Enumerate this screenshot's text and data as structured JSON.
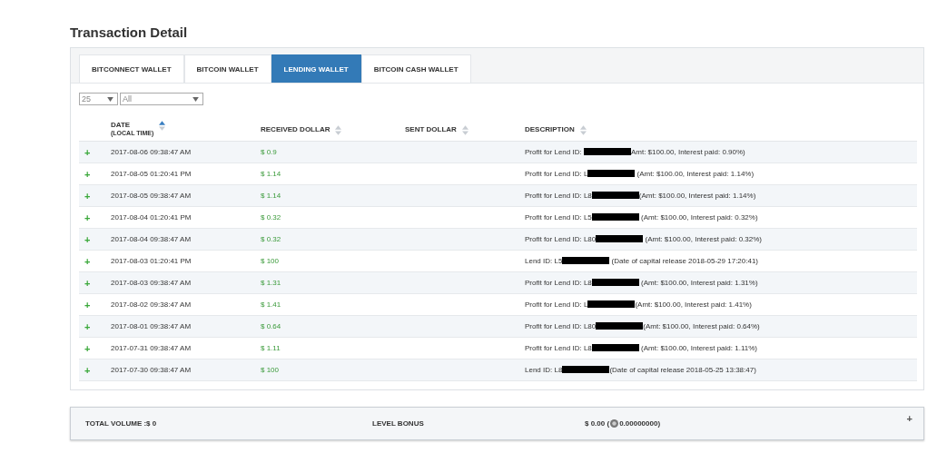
{
  "title": "Transaction Detail",
  "tabs": [
    {
      "label": "BITCONNECT WALLET",
      "selected": false
    },
    {
      "label": "BITCOIN WALLET",
      "selected": false
    },
    {
      "label": "LENDING WALLET",
      "selected": true
    },
    {
      "label": "BITCOIN CASH WALLET",
      "selected": false
    }
  ],
  "filters": {
    "page_size": "25",
    "type": "All"
  },
  "columns": [
    {
      "label": "DATE",
      "sublabel": "(LOCAL TIME)",
      "sorted": true
    },
    {
      "label": "RECEIVED DOLLAR",
      "sorted": false
    },
    {
      "label": "SENT DOLLAR",
      "sorted": false
    },
    {
      "label": "DESCRIPTION",
      "sorted": false
    }
  ],
  "rows": [
    {
      "expand": "+",
      "date": "2017-08-06 09:38:47 AM",
      "received": "$ 0.9",
      "description": {
        "prefix": "Profit for Lend ID: ",
        "suffix": "Amt: $100.00, Interest paid: 0.90%)"
      }
    },
    {
      "expand": "+",
      "date": "2017-08-05 01:20:41 PM",
      "received": "$ 1.14",
      "description": {
        "prefix": "Profit for Lend ID: L",
        "suffix": " (Amt: $100.00, Interest paid: 1.14%)"
      }
    },
    {
      "expand": "+",
      "date": "2017-08-05 09:38:47 AM",
      "received": "$ 1.14",
      "description": {
        "prefix": "Profit for Lend ID: L8",
        "suffix": "(Amt: $100.00, Interest paid: 1.14%)"
      }
    },
    {
      "expand": "+",
      "date": "2017-08-04 01:20:41 PM",
      "received": "$ 0.32",
      "description": {
        "prefix": "Profit for Lend ID: L5",
        "suffix": " (Amt: $100.00, Interest paid: 0.32%)"
      }
    },
    {
      "expand": "+",
      "date": "2017-08-04 09:38:47 AM",
      "received": "$ 0.32",
      "description": {
        "prefix": "Profit for Lend ID: L80",
        "suffix": " (Amt: $100.00, Interest paid: 0.32%)"
      }
    },
    {
      "expand": "+",
      "date": "2017-08-03 01:20:41 PM",
      "received": "$ 100",
      "description": {
        "prefix": "Lend ID: L5",
        "suffix": " (Date of capital release 2018-05-29 17:20:41)"
      }
    },
    {
      "expand": "+",
      "date": "2017-08-03 09:38:47 AM",
      "received": "$ 1.31",
      "description": {
        "prefix": "Profit for Lend ID: L8",
        "suffix": " (Amt: $100.00, Interest paid: 1.31%)"
      }
    },
    {
      "expand": "+",
      "date": "2017-08-02 09:38:47 AM",
      "received": "$ 1.41",
      "description": {
        "prefix": "Profit for Lend ID: L",
        "suffix": "(Amt: $100.00, Interest paid: 1.41%)"
      }
    },
    {
      "expand": "+",
      "date": "2017-08-01 09:38:47 AM",
      "received": "$ 0.64",
      "description": {
        "prefix": "Profit for Lend ID: L80",
        "suffix": "(Amt: $100.00, Interest paid: 0.64%)"
      }
    },
    {
      "expand": "+",
      "date": "2017-07-31 09:38:47 AM",
      "received": "$ 1.11",
      "description": {
        "prefix": "Profit for Lend ID: L8",
        "suffix": " (Amt: $100.00, Interest paid: 1.11%)"
      }
    },
    {
      "expand": "+",
      "date": "2017-07-30 09:38:47 AM",
      "received": "$ 100",
      "description": {
        "prefix": "Lend ID: L8",
        "suffix": "(Date of capital release 2018-05-25 13:38:47)"
      }
    }
  ],
  "summary": {
    "total_volume": "TOTAL VOLUME :$ 0",
    "level_bonus_label": "LEVEL BONUS",
    "level_bonus_value": "$ 0.00 (",
    "level_bonus_coins": "0.00000000)",
    "expand": "+"
  }
}
